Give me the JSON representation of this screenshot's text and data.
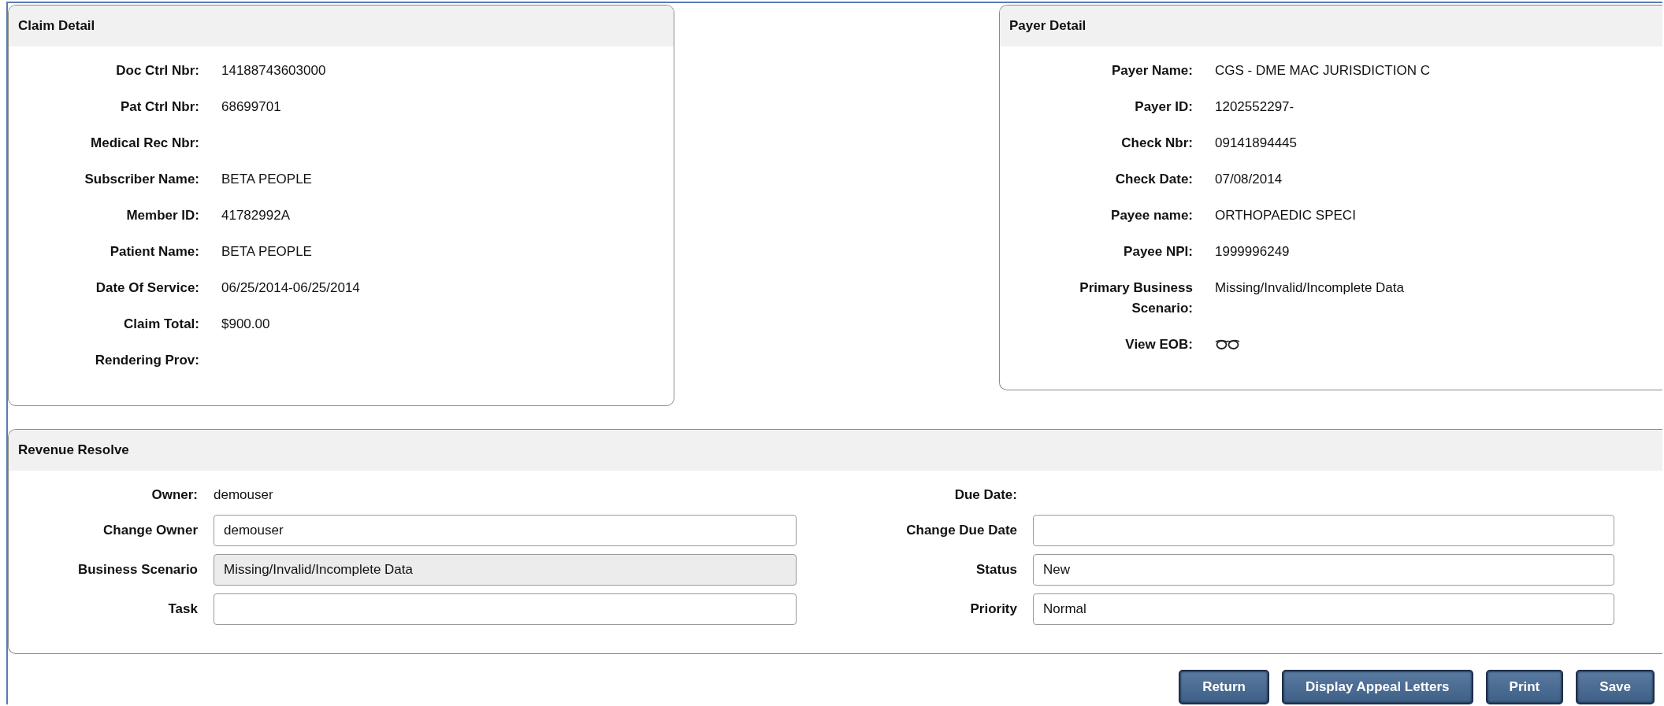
{
  "claim_detail": {
    "title": "Claim Detail",
    "fields": [
      {
        "kind": "text",
        "label": "Doc Ctrl Nbr:",
        "value": "14188743603000"
      },
      {
        "kind": "text",
        "label": "Pat Ctrl Nbr:",
        "value": "68699701"
      },
      {
        "kind": "text",
        "label": "Medical Rec Nbr:"
      },
      {
        "kind": "text",
        "label": "Subscriber Name:",
        "value": "BETA PEOPLE"
      },
      {
        "kind": "text",
        "label": "Member ID:",
        "value": "41782992A"
      },
      {
        "kind": "text",
        "label": "Patient Name:",
        "value": "BETA PEOPLE"
      },
      {
        "kind": "text",
        "label": "Date Of Service:",
        "value": "06/25/2014-06/25/2014"
      },
      {
        "kind": "text",
        "label": "Claim Total:",
        "value": "$900.00"
      },
      {
        "kind": "text",
        "label": "Rendering Prov:"
      }
    ]
  },
  "payer_detail": {
    "title": "Payer Detail",
    "fields": [
      {
        "kind": "text",
        "label": "Payer Name:",
        "value": "CGS - DME MAC JURISDICTION C"
      },
      {
        "kind": "text",
        "label": "Payer ID:",
        "value": "1202552297-"
      },
      {
        "kind": "text",
        "label": "Check Nbr:",
        "value": "09141894445"
      },
      {
        "kind": "text",
        "label": "Check Date:",
        "value": "07/08/2014"
      },
      {
        "kind": "text",
        "label": "Payee name:",
        "value": "ORTHOPAEDIC SPECI"
      },
      {
        "kind": "text",
        "label": "Payee NPI:",
        "value": "1999996249"
      },
      {
        "kind": "text",
        "label": "Primary Business Scenario:",
        "value": "Missing/Invalid/Incomplete Data"
      },
      {
        "kind": "icon",
        "label": "View EOB:"
      }
    ]
  },
  "revenue_resolve": {
    "title": "Revenue Resolve",
    "left": [
      {
        "kind": "text",
        "label": "Owner:",
        "value": "demouser"
      },
      {
        "kind": "input",
        "label": "Change Owner",
        "value": "demouser",
        "disabled": false
      },
      {
        "kind": "input",
        "label": "Business Scenario",
        "value": "Missing/Invalid/Incomplete Data",
        "disabled": true
      },
      {
        "kind": "input",
        "label": "Task",
        "disabled": false
      }
    ],
    "right": [
      {
        "kind": "text",
        "label": "Due Date:"
      },
      {
        "kind": "input",
        "label": "Change Due Date",
        "disabled": false
      },
      {
        "kind": "input",
        "label": "Status",
        "value": "New",
        "disabled": false
      },
      {
        "kind": "input",
        "label": "Priority",
        "value": "Normal",
        "disabled": false
      }
    ]
  },
  "buttons": [
    "Return",
    "Display Appeal Letters",
    "Print",
    "Save"
  ]
}
